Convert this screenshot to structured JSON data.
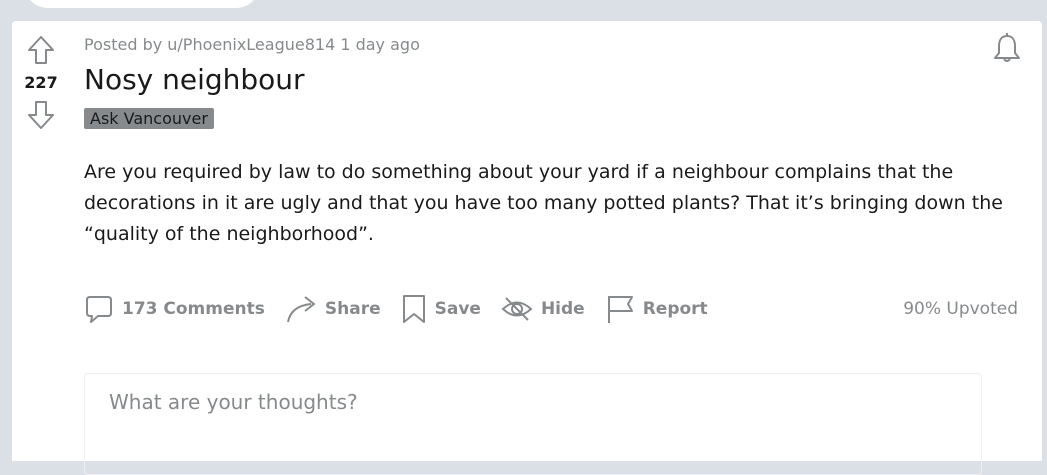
{
  "post": {
    "meta": "Posted by u/PhoenixLeague814 1 day ago",
    "score": "227",
    "title": "Nosy neighbour",
    "flair": "Ask Vancouver",
    "body": "Are you required by law to do something about your yard if a neighbour complains that the decorations in it are ugly and that you have too many potted plants? That it’s bringing down the “quality of the neighborhood”."
  },
  "actions": {
    "comments": "173 Comments",
    "share": "Share",
    "save": "Save",
    "hide": "Hide",
    "report": "Report",
    "upvoted": "90% Upvoted"
  },
  "comment": {
    "placeholder": "What are your thoughts?"
  },
  "icons": {
    "upvote": "arrow-up-icon",
    "downvote": "arrow-down-icon",
    "bell": "bell-icon",
    "comments": "speech-bubble-icon",
    "share": "share-arrow-icon",
    "save": "bookmark-icon",
    "hide": "eye-slash-icon",
    "report": "flag-icon"
  }
}
